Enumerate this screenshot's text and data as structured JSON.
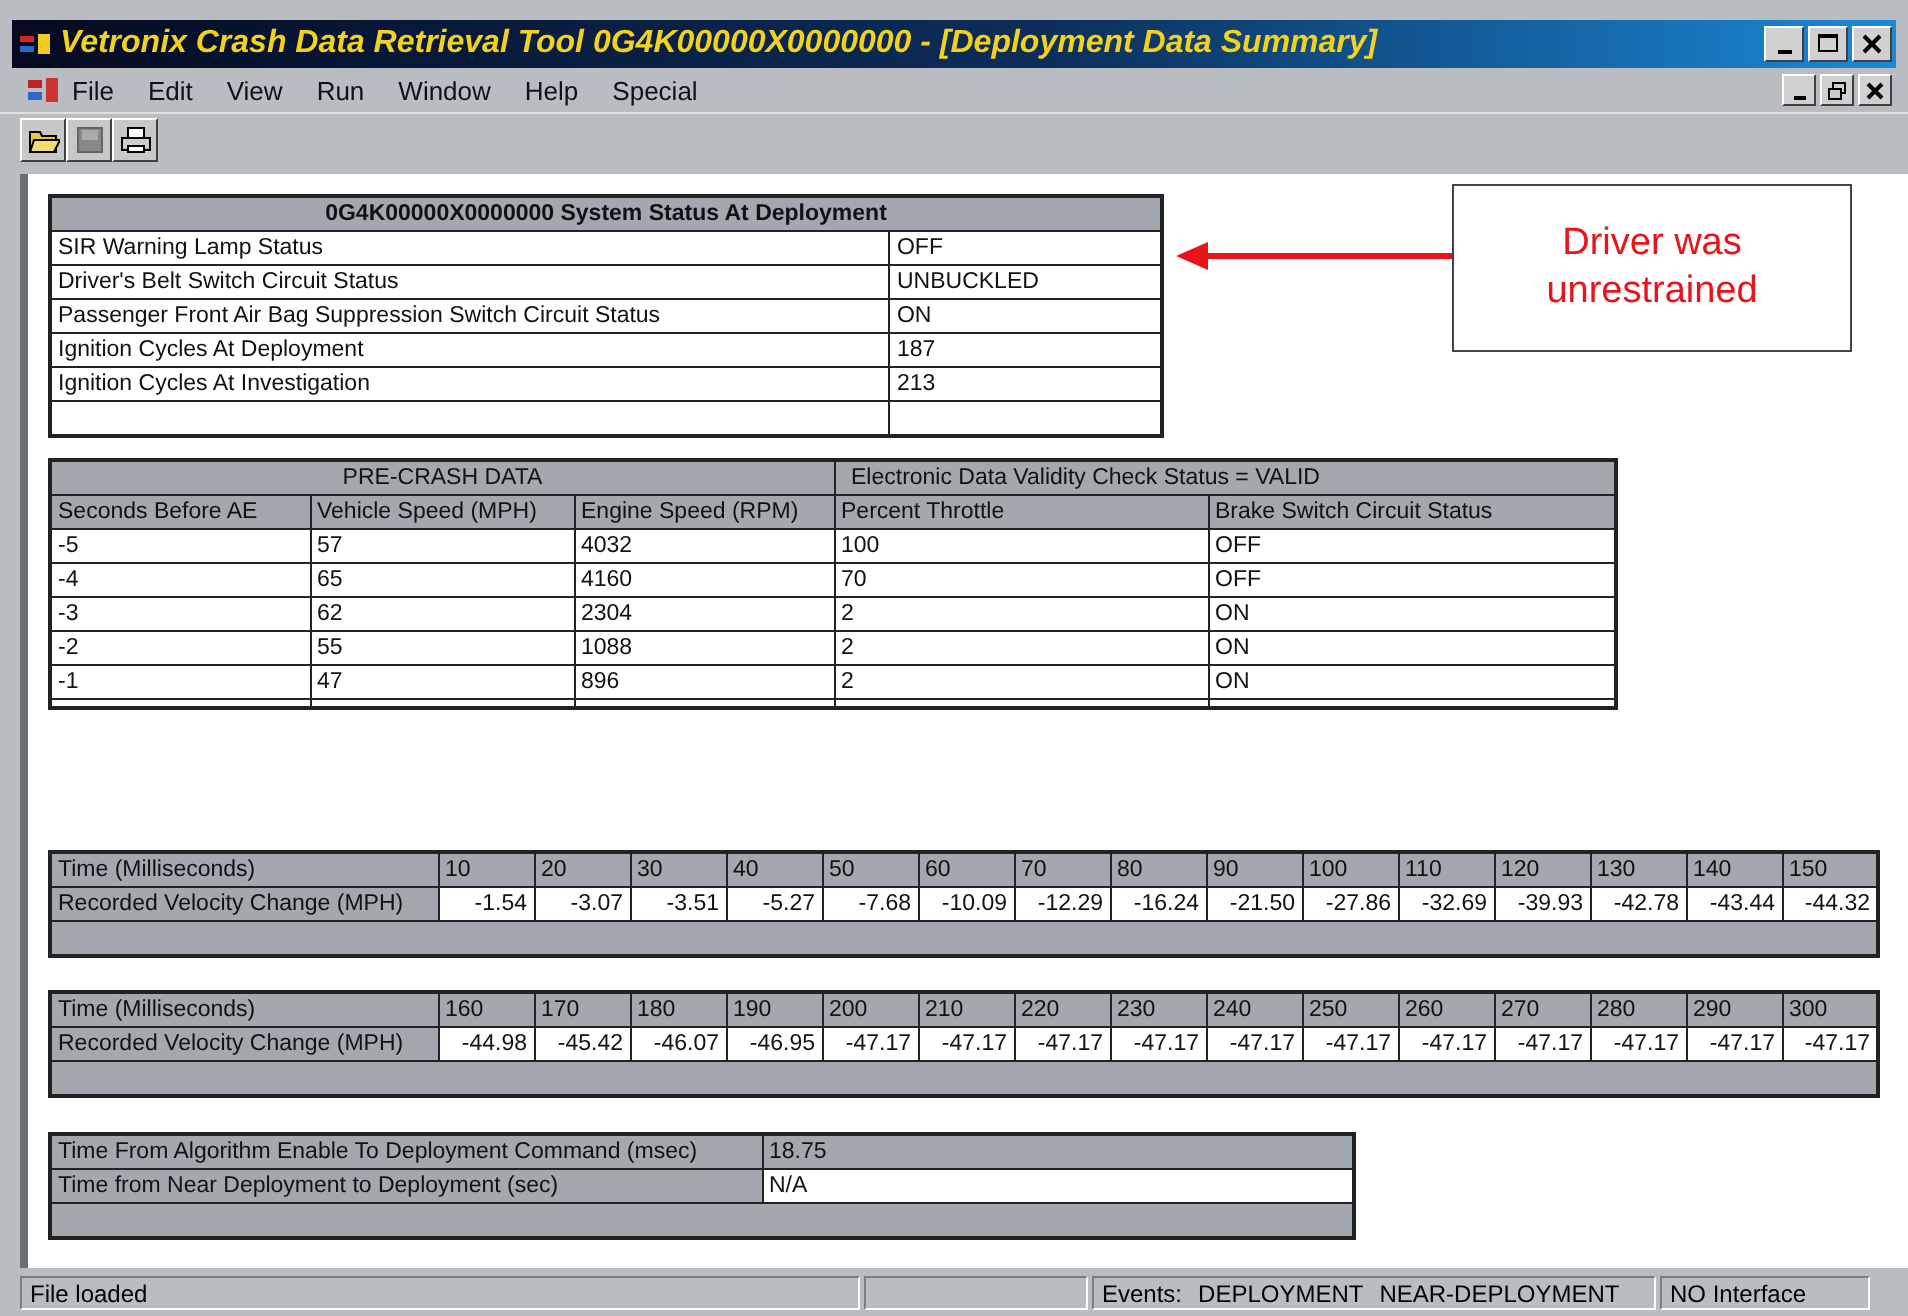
{
  "window": {
    "title": "Vetronix Crash Data Retrieval Tool  0G4K00000X0000000 - [Deployment Data Summary]"
  },
  "menu": [
    "File",
    "Edit",
    "View",
    "Run",
    "Window",
    "Help",
    "Special"
  ],
  "system_status": {
    "title": "0G4K00000X0000000  System Status At Deployment",
    "rows": [
      {
        "label": "SIR Warning Lamp Status",
        "value": "OFF"
      },
      {
        "label": "Driver's Belt Switch Circuit Status",
        "value": "UNBUCKLED"
      },
      {
        "label": "Passenger Front Air Bag Suppression Switch Circuit Status",
        "value": "ON"
      },
      {
        "label": "Ignition Cycles At Deployment",
        "value": "187"
      },
      {
        "label": "Ignition Cycles At Investigation",
        "value": "213"
      }
    ]
  },
  "annotation": {
    "text": "Driver was unrestrained"
  },
  "pre_crash": {
    "title": "PRE-CRASH  DATA",
    "validity": "Electronic Data Validity Check Status = VALID",
    "columns": [
      "Seconds Before AE",
      "Vehicle Speed (MPH)",
      "Engine Speed (RPM)",
      "Percent Throttle",
      "Brake Switch Circuit Status"
    ],
    "rows": [
      [
        "-5",
        "57",
        "4032",
        "100",
        "OFF"
      ],
      [
        "-4",
        "65",
        "4160",
        "70",
        "OFF"
      ],
      [
        "-3",
        "62",
        "2304",
        "2",
        "ON"
      ],
      [
        "-2",
        "55",
        "1088",
        "2",
        "ON"
      ],
      [
        "-1",
        "47",
        "896",
        "2",
        "ON"
      ]
    ]
  },
  "velocity_tables": [
    {
      "time_label": "Time (Milliseconds)",
      "change_label": "Recorded Velocity Change (MPH)",
      "times": [
        "10",
        "20",
        "30",
        "40",
        "50",
        "60",
        "70",
        "80",
        "90",
        "100",
        "110",
        "120",
        "130",
        "140",
        "150"
      ],
      "values": [
        "-1.54",
        "-3.07",
        "-3.51",
        "-5.27",
        "-7.68",
        "-10.09",
        "-12.29",
        "-16.24",
        "-21.50",
        "-27.86",
        "-32.69",
        "-39.93",
        "-42.78",
        "-43.44",
        "-44.32"
      ]
    },
    {
      "time_label": "Time (Milliseconds)",
      "change_label": "Recorded Velocity Change (MPH)",
      "times": [
        "160",
        "170",
        "180",
        "190",
        "200",
        "210",
        "220",
        "230",
        "240",
        "250",
        "260",
        "270",
        "280",
        "290",
        "300"
      ],
      "values": [
        "-44.98",
        "-45.42",
        "-46.07",
        "-46.95",
        "-47.17",
        "-47.17",
        "-47.17",
        "-47.17",
        "-47.17",
        "-47.17",
        "-47.17",
        "-47.17",
        "-47.17",
        "-47.17",
        "-47.17"
      ]
    }
  ],
  "timing": [
    {
      "label": "Time From Algorithm Enable To Deployment Command (msec)",
      "value": "18.75",
      "shaded": true
    },
    {
      "label": "Time from Near Deployment to Deployment (sec)",
      "value": "N/A",
      "shaded": false
    }
  ],
  "status_bar": {
    "message": "File loaded",
    "events_label": "Events:",
    "events": [
      "DEPLOYMENT",
      "NEAR-DEPLOYMENT"
    ],
    "interface": "NO Interface"
  }
}
